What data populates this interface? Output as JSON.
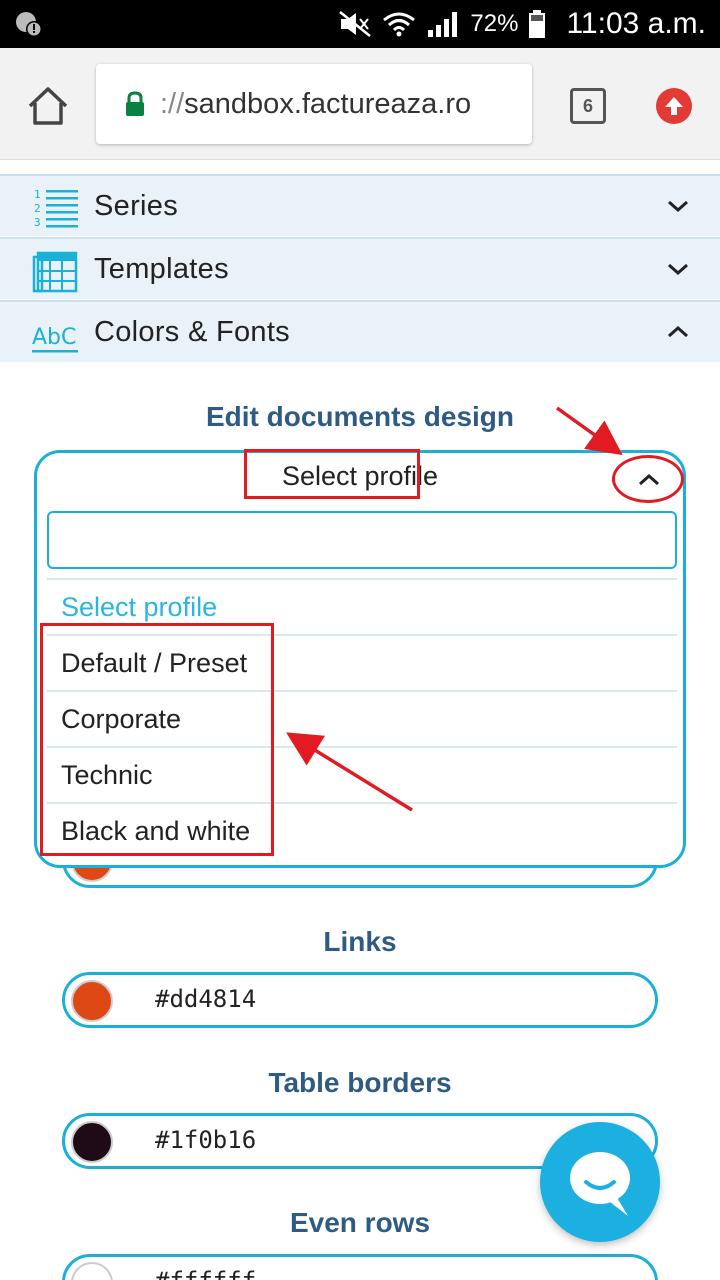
{
  "status_bar": {
    "battery_percent": "72%",
    "time": "11:03 a.m."
  },
  "browser": {
    "url_scheme": "://",
    "url_host": "sandbox.factureaza.ro",
    "tab_count": "6"
  },
  "accordion": {
    "items": [
      {
        "label": "Series",
        "expanded": false
      },
      {
        "label": "Templates",
        "expanded": false
      },
      {
        "label": "Colors & Fonts",
        "expanded": true
      }
    ]
  },
  "design": {
    "title": "Edit documents design",
    "profile_select": {
      "selected": "Select profile",
      "search_value": "",
      "options": [
        "Select profile",
        "Default / Preset",
        "Corporate",
        "Technic",
        "Black and white"
      ]
    }
  },
  "colors": [
    {
      "label": "Links",
      "value": "#dd4814"
    },
    {
      "label": "Table borders",
      "value": "#1f0b16"
    },
    {
      "label": "Even rows",
      "value": "#ffffff"
    }
  ],
  "theme": {
    "accent": "#1bb0d8",
    "heading": "#2e5b85",
    "annotation": "#e21b23",
    "hidden_swatch": "#dd4814"
  }
}
